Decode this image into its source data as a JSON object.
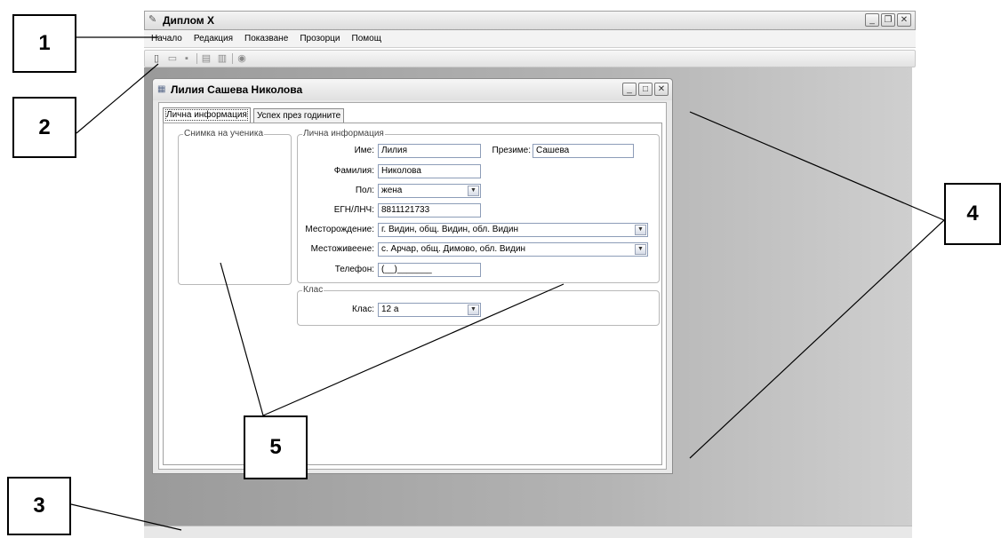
{
  "app": {
    "title": "Диплом X",
    "menu": [
      "Начало",
      "Редакция",
      "Показване",
      "Прозорци",
      "Помощ"
    ],
    "toolbar_icons": [
      "new-document-icon",
      "open-folder-icon",
      "save-icon",
      "print-icon",
      "print-preview-icon",
      "globe-icon"
    ]
  },
  "child": {
    "title": "Лилия Сашева Николова",
    "tabs": [
      "Лична информация",
      "Успех през годините"
    ],
    "photo_group": "Снимка на ученика",
    "info_group": "Лична информация",
    "fields": {
      "first_name": {
        "label": "Име:",
        "value": "Лилия"
      },
      "middle_name": {
        "label": "Презиме:",
        "value": "Сашева"
      },
      "last_name": {
        "label": "Фамилия:",
        "value": "Николова"
      },
      "gender": {
        "label": "Пол:",
        "value": "жена"
      },
      "egn": {
        "label": "ЕГН/ЛНЧ:",
        "value": "8811121733"
      },
      "birthplace": {
        "label": "Месторождение:",
        "value": "г. Видин, общ. Видин, обл. Видин"
      },
      "residence": {
        "label": "Местоживеене:",
        "value": "с. Арчар, общ. Димово, обл. Видин"
      },
      "phone": {
        "label": "Телефон:",
        "value": "(__)_______"
      }
    },
    "class_group": "Клас",
    "class_field": {
      "label": "Клас:",
      "value": "12 а"
    }
  },
  "callouts": [
    "1",
    "2",
    "3",
    "4",
    "5"
  ]
}
